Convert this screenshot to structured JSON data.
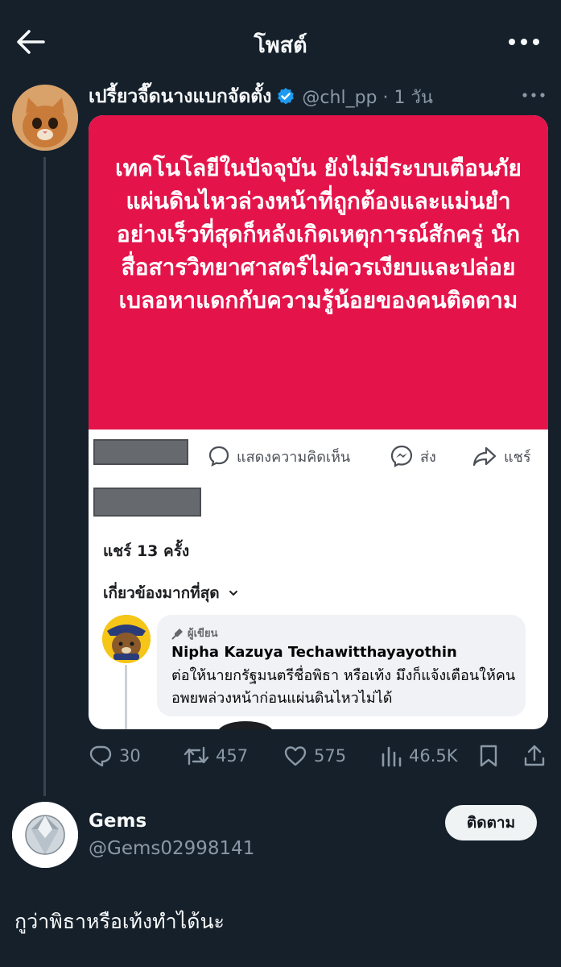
{
  "header": {
    "title": "โพสต์"
  },
  "tweet": {
    "author_name": "เปรี้ยวจี๊ดนางแบกจัดตั้ง",
    "handle_time": "@chl_pp · 1 วัน",
    "media": {
      "quote_text": "เทคโนโลยีในปัจจุบัน ยังไม่มีระบบเตือนภัยแผ่นดินไหวล่วงหน้าที่ถูกต้องและแม่นยำ อย่างเร็วที่สุดก็หลังเกิดเหตุการณ์สักครู่ นักสื่อสารวิทยาศาสตร์ไม่ควรเงียบและปล่อยเบลอหาแดกกับความรู้น้อยของคนติดตาม",
      "actions": {
        "comment": "แสดงความคิดเห็น",
        "send": "ส่ง",
        "share": "แชร์"
      },
      "shares_count": "แชร์ 13 ครั้ง",
      "sort_label": "เกี่ยวข้องมากที่สุด",
      "comment": {
        "badge": "ผู้เขียน",
        "name": "Nipha Kazuya Techawitthayayothin",
        "text": "ต่อให้นายกรัฐมนตรีชื่อพิธา หรือเท้ง มึงก็แจ้งเตือนให้คนอพยพล่วงหน้าก่อนแผ่นดินไหวไม่ได้"
      }
    },
    "metrics": {
      "replies": "30",
      "retweets": "457",
      "likes": "575",
      "views": "46.5K"
    }
  },
  "reply": {
    "name": "Gems",
    "handle": "@Gems02998141",
    "follow_label": "ติดตาม",
    "text": "กูว่าพิธาหรือเท้งทำได้นะ"
  },
  "colors": {
    "background": "#15202b",
    "quote_red": "#e4144b",
    "verified_blue": "#1d9bf0",
    "muted": "#8b98a5"
  }
}
